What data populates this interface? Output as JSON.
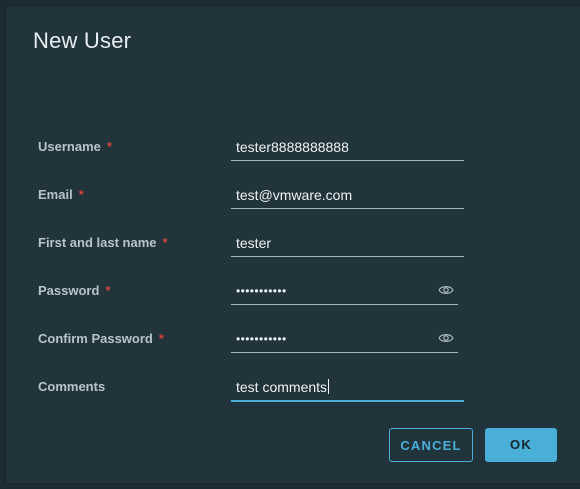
{
  "dialog": {
    "title": "New User"
  },
  "form": {
    "required_marker": "*",
    "username": {
      "label": "Username",
      "value": "tester8888888888"
    },
    "email": {
      "label": "Email",
      "value": "test@vmware.com"
    },
    "full_name": {
      "label": "First and last name",
      "value": "tester"
    },
    "password": {
      "label": "Password",
      "value": "•••••••••••"
    },
    "confirm_password": {
      "label": "Confirm Password",
      "value": "•••••••••••"
    },
    "comments": {
      "label": "Comments",
      "value": "test comments"
    }
  },
  "buttons": {
    "cancel": "CANCEL",
    "ok": "OK"
  },
  "icons": {
    "show_password": "eye-icon"
  },
  "colors": {
    "accent": "#49afd9",
    "required": "#d0453a",
    "dialog_background": "#21333b"
  }
}
